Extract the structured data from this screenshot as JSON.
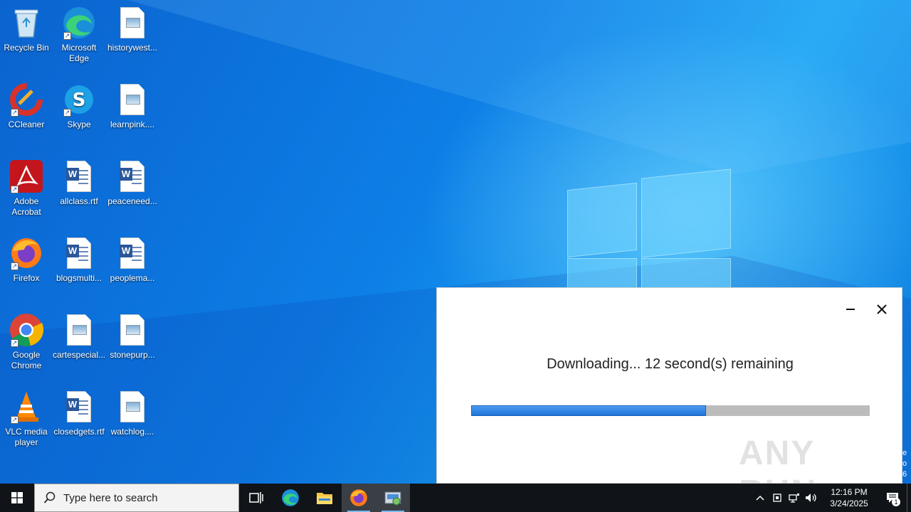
{
  "desktop": {
    "icons": [
      {
        "label": "Recycle Bin"
      },
      {
        "label": "Microsoft Edge"
      },
      {
        "label": "historywest..."
      },
      {
        "label": "CCleaner"
      },
      {
        "label": "Skype"
      },
      {
        "label": "learnpink...."
      },
      {
        "label": "Adobe Acrobat"
      },
      {
        "label": "allclass.rtf"
      },
      {
        "label": "peaceneed..."
      },
      {
        "label": "Firefox"
      },
      {
        "label": "blogsmulti..."
      },
      {
        "label": "peoplema..."
      },
      {
        "label": "Google Chrome"
      },
      {
        "label": "cartespecial..."
      },
      {
        "label": "stonepurp..."
      },
      {
        "label": "VLC media player"
      },
      {
        "label": "closedgets.rtf"
      },
      {
        "label": "watchlog...."
      }
    ]
  },
  "dialog": {
    "message": "Downloading... 12 second(s) remaining",
    "progress_fraction": 0.59,
    "watermark": "ANY RUN"
  },
  "edge_strip": {
    "chars": [
      "e",
      "o",
      "6"
    ]
  },
  "taskbar": {
    "search_placeholder": "Type here to search",
    "apps": [
      "task-view",
      "microsoft-edge",
      "file-explorer",
      "firefox",
      "installer"
    ],
    "clock_time": "12:16 PM",
    "clock_date": "3/24/2025",
    "notification_count": "1"
  },
  "colors": {
    "accent": "#1f74d8",
    "taskbar_bg": "#101418",
    "progress_track": "#bcbcbc"
  }
}
